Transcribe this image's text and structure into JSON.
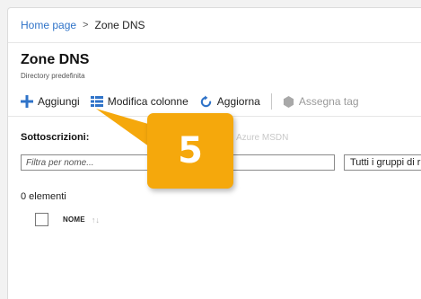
{
  "breadcrumb": {
    "home": "Home page",
    "separator": ">",
    "current": "Zone DNS"
  },
  "header": {
    "title": "Zone DNS",
    "subtitle": "Directory predefinita"
  },
  "toolbar": {
    "add_label": "Aggiungi",
    "columns_label": "Modifica colonne",
    "refresh_label": "Aggiorna",
    "tags_label": "Assegna tag",
    "accent_color": "#2f73c8"
  },
  "subscriptions": {
    "label": "Sottoscrizioni:",
    "value": "Azure MSDN"
  },
  "filter": {
    "placeholder": "Filtra per nome...",
    "select_value": "Tutti i gruppi di risorse"
  },
  "list": {
    "count": "0 elementi",
    "column_name": "NOME",
    "sort_icon": "↑↓"
  },
  "callout": {
    "number": "5",
    "color": "#f5a80c"
  }
}
